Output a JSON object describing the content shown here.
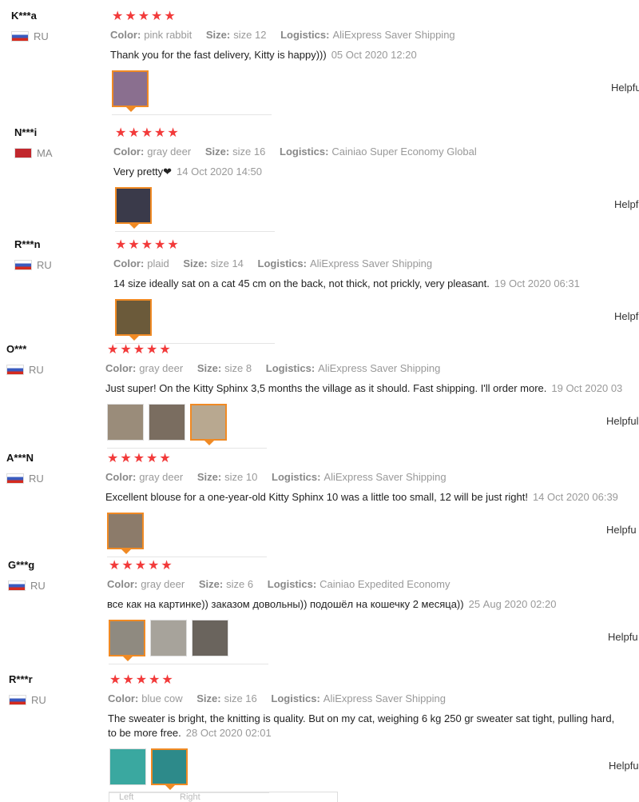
{
  "reviews": [
    {
      "user": "K***a",
      "country": "RU",
      "stars": "★★★★★",
      "color": "pink rabbit",
      "size": "size 12",
      "logistics": "AliExpress Saver Shipping",
      "text": "Thank you for the fast delivery, Kitty is happy)))",
      "date": "05 Oct 2020 12:20",
      "thumbs": 1,
      "helpful": "Helpfu"
    },
    {
      "user": "N***i",
      "country": "MA",
      "stars": "★★★★★",
      "color": "gray deer",
      "size": "size 16",
      "logistics": "Cainiao Super Economy Global",
      "text": "Very pretty❤",
      "date": "14 Oct 2020 14:50",
      "thumbs": 1,
      "helpful": "Helpf"
    },
    {
      "user": "R***n",
      "country": "RU",
      "stars": "★★★★★",
      "color": "plaid",
      "size": "size 14",
      "logistics": "AliExpress Saver Shipping",
      "text": "14 size ideally sat on a cat 45 cm on the back, not thick, not prickly, very pleasant.",
      "date": "19 Oct 2020 06:31",
      "thumbs": 1,
      "helpful": "Helpf"
    },
    {
      "user": "O***",
      "country": "RU",
      "stars": "★★★★★",
      "color": "gray deer",
      "size": "size 8",
      "logistics": "AliExpress Saver Shipping",
      "text": "Just super! On the Kitty Sphinx 3,5 months the village as it should. Fast shipping. I'll order more.",
      "date": "19 Oct 2020 03",
      "thumbs": 3,
      "helpful": "Helpful"
    },
    {
      "user": "A***N",
      "country": "RU",
      "stars": "★★★★★",
      "color": "gray deer",
      "size": "size 10",
      "logistics": "AliExpress Saver Shipping",
      "text": "Excellent blouse for a one-year-old Kitty Sphinx 10 was a little too small, 12 will be just right!",
      "date": "14 Oct 2020 06:39",
      "thumbs": 1,
      "helpful": "Helpfu"
    },
    {
      "user": "G***g",
      "country": "RU",
      "stars": "★★★★★",
      "color": "gray deer",
      "size": "size 6",
      "logistics": "Cainiao Expedited Economy",
      "text": "все как на картинке)) заказом довольны)) подошёл на кошечку 2 месяца))",
      "date": "25 Aug 2020 02:20",
      "thumbs": 3,
      "helpful": "Helpfu"
    },
    {
      "user": "R***r",
      "country": "RU",
      "stars": "★★★★★",
      "color": "blue cow",
      "size": "size 16",
      "logistics": "AliExpress Saver Shipping",
      "text": "The sweater is bright, the knitting is quality. But on my cat, weighing 6 kg 250 gr sweater sat tight, pulling hard,",
      "text2": "to be more free.",
      "date": "28 Oct 2020 02:01",
      "thumbs": 2,
      "helpful": "Helpfu"
    }
  ],
  "labels": {
    "color": "Color:",
    "size": "Size:",
    "logistics": "Logistics:"
  },
  "bottom": {
    "left": "Left",
    "right": "Right"
  }
}
